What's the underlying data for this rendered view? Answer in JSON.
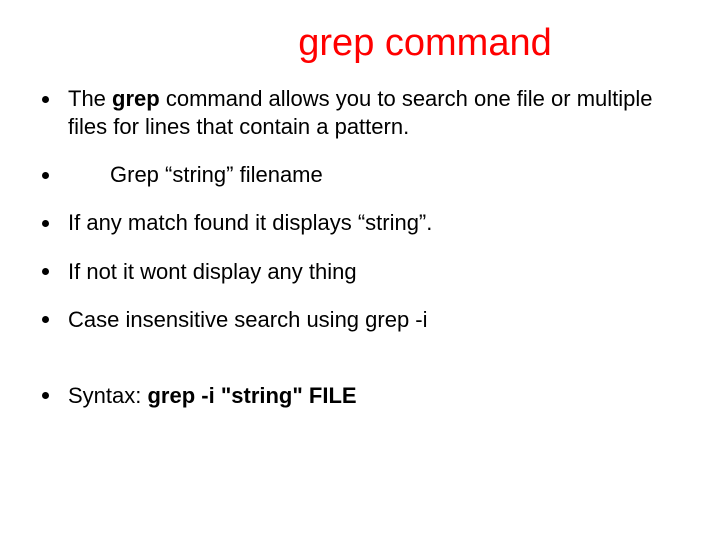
{
  "title": "grep command",
  "bullets": {
    "b0_pre": "The ",
    "b0_bold": "grep",
    "b0_post": " command allows you to search one file or multiple files for lines that contain a pattern.",
    "b1": "Grep “string” filename",
    "b2": "If any match found it displays “string”.",
    "b3": "If not it wont display any thing",
    "b4": "Case insensitive search using grep -i",
    "b5_pre": "Syntax: ",
    "b5_bold": "grep -i \"string\" FILE"
  }
}
